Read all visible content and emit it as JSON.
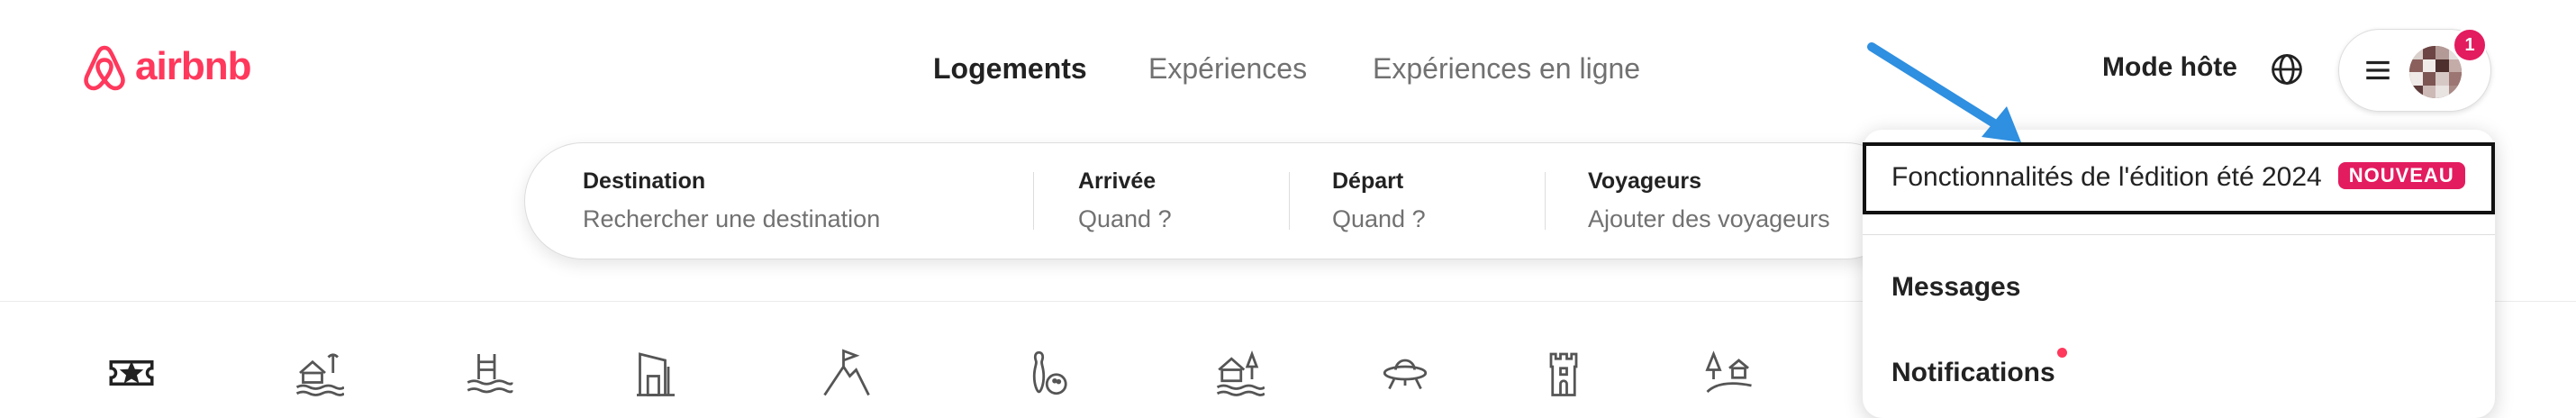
{
  "brand": {
    "name": "airbnb",
    "color": "#ff385c"
  },
  "nav": {
    "tabs": [
      {
        "label": "Logements",
        "active": true
      },
      {
        "label": "Expériences",
        "active": false
      },
      {
        "label": "Expériences en ligne",
        "active": false
      }
    ]
  },
  "header": {
    "host_mode": "Mode hôte",
    "globe_icon": "globe-icon",
    "menu_icon": "hamburger-menu-icon",
    "notification_count": "1"
  },
  "search": {
    "fields": [
      {
        "label": "Destination",
        "value": "Rechercher une destination"
      },
      {
        "label": "Arrivée",
        "value": "Quand ?"
      },
      {
        "label": "Départ",
        "value": "Quand ?"
      },
      {
        "label": "Voyageurs",
        "value": "Ajouter des voyageurs"
      }
    ]
  },
  "categories": [
    "ticket-icon",
    "beach-hut-icon",
    "pool-icon",
    "doorframe-icon",
    "mountain-flag-icon",
    "bowling-icon",
    "lakehouse-icon",
    "ufo-icon",
    "castle-icon",
    "countryside-icon"
  ],
  "dropdown": {
    "feature_item": "Fonctionnalités de l'édition été 2024",
    "feature_badge": "NOUVEAU",
    "messages": "Messages",
    "notifications": "Notifications"
  },
  "colors": {
    "accent": "#e31c5f",
    "annotation_arrow": "#2f8fe0"
  }
}
